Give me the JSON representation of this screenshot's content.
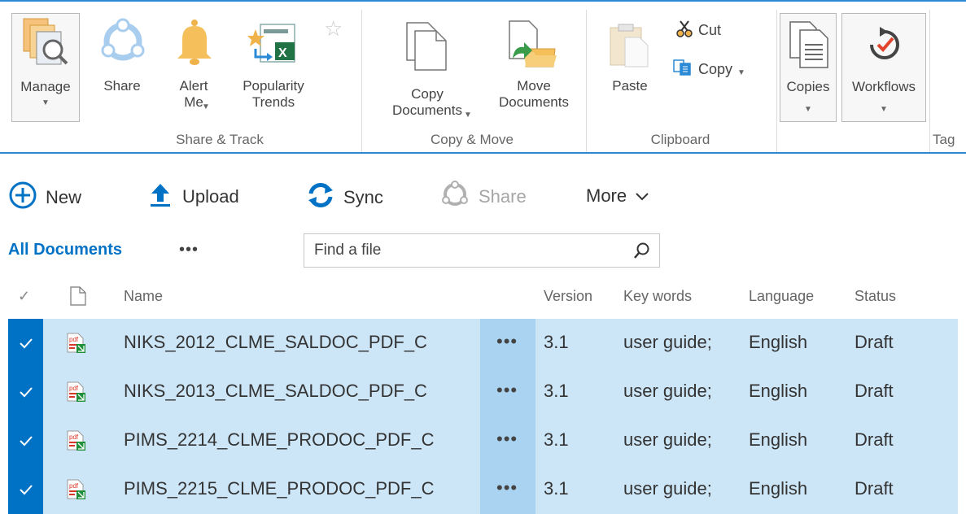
{
  "ribbon": {
    "buttons": {
      "manage": {
        "label": "Manage",
        "icon": "manage-permissions-icon"
      },
      "share": {
        "label": "Share",
        "icon": "share-icon"
      },
      "alert_me": {
        "label": "Alert\nMe",
        "icon": "bell-icon"
      },
      "popularity_trends": {
        "label": "Popularity\nTrends",
        "icon": "popularity-trends-icon"
      },
      "copy_documents": {
        "label": "Copy\nDocuments",
        "icon": "copy-documents-icon"
      },
      "move_documents": {
        "label": "Move\nDocuments",
        "icon": "move-documents-icon"
      },
      "paste": {
        "label": "Paste",
        "icon": "paste-icon"
      },
      "cut": {
        "label": "Cut",
        "icon": "scissors-icon"
      },
      "copy": {
        "label": "Copy",
        "icon": "copy-icon"
      },
      "copies": {
        "label": "Copies",
        "icon": "copies-icon"
      },
      "workflows": {
        "label": "Workflows",
        "icon": "workflows-icon"
      }
    },
    "groups": {
      "share_track": "Share & Track",
      "copy_move": "Copy & Move",
      "clipboard": "Clipboard",
      "tags_partial": "Tag"
    }
  },
  "commands": {
    "new": "New",
    "upload": "Upload",
    "sync": "Sync",
    "share": "Share",
    "more": "More"
  },
  "view": {
    "name": "All Documents",
    "more": "•••",
    "search_placeholder": "Find a file"
  },
  "table": {
    "headers": {
      "check": "✓",
      "name": "Name",
      "version": "Version",
      "keywords": "Key words",
      "language": "Language",
      "status": "Status"
    },
    "rows": [
      {
        "name": "NIKS_2012_CLME_SALDOC_PDF_C",
        "ellipsis": "•••",
        "version": "3.1",
        "keywords": "user guide;",
        "language": "English",
        "status": "Draft",
        "selected": true
      },
      {
        "name": "NIKS_2013_CLME_SALDOC_PDF_C",
        "ellipsis": "•••",
        "version": "3.1",
        "keywords": "user guide;",
        "language": "English",
        "status": "Draft",
        "selected": true
      },
      {
        "name": "PIMS_2214_CLME_PRODOC_PDF_C",
        "ellipsis": "•••",
        "version": "3.1",
        "keywords": "user guide;",
        "language": "English",
        "status": "Draft",
        "selected": true
      },
      {
        "name": "PIMS_2215_CLME_PRODOC_PDF_C",
        "ellipsis": "•••",
        "version": "3.1",
        "keywords": "user guide;",
        "language": "English",
        "status": "Draft",
        "selected": true
      }
    ]
  },
  "colors": {
    "accent": "#0072c6",
    "ribbon_line": "#2b8ad6",
    "row_selected": "#cde6f7",
    "ellipsis_cell": "#a9d3f1"
  }
}
